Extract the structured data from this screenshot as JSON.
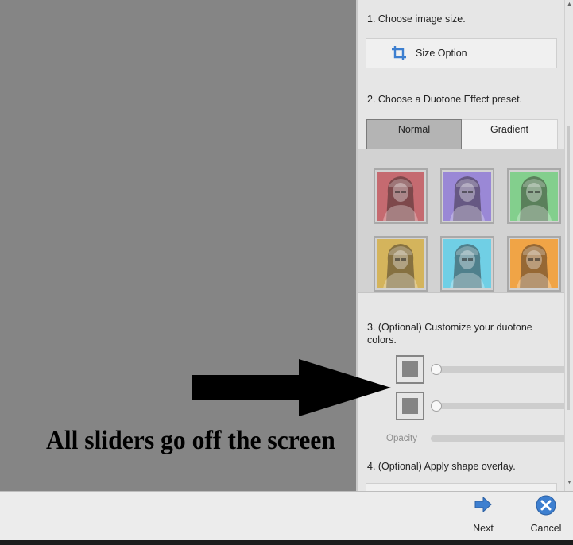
{
  "panel": {
    "step1_label": "1. Choose image size.",
    "size_option_label": "Size Option",
    "step2_label": "2. Choose a Duotone Effect preset.",
    "tabs": [
      {
        "label": "Normal",
        "selected": true
      },
      {
        "label": "Gradient",
        "selected": false
      }
    ],
    "presets": [
      {
        "name": "red",
        "color": "#c56a70"
      },
      {
        "name": "purple",
        "color": "#9a88d6"
      },
      {
        "name": "green",
        "color": "#83cf8d"
      },
      {
        "name": "yellow",
        "color": "#d4b45c"
      },
      {
        "name": "cyan",
        "color": "#70cfe5"
      },
      {
        "name": "orange",
        "color": "#f0a446"
      }
    ],
    "step3_label": "3. (Optional) Customize your duotone colors.",
    "color1_swatch": "#858585",
    "color2_swatch": "#858585",
    "opacity_label": "Opacity",
    "step4_label": "4. (Optional) Apply shape overlay."
  },
  "footer": {
    "next_label": "Next",
    "cancel_label": "Cancel"
  },
  "annotation": {
    "text": "All sliders go off the screen"
  },
  "colors": {
    "accent_blue": "#3d7fd0",
    "panel_bg": "#e6e6e6",
    "canvas_bg": "#858585"
  }
}
